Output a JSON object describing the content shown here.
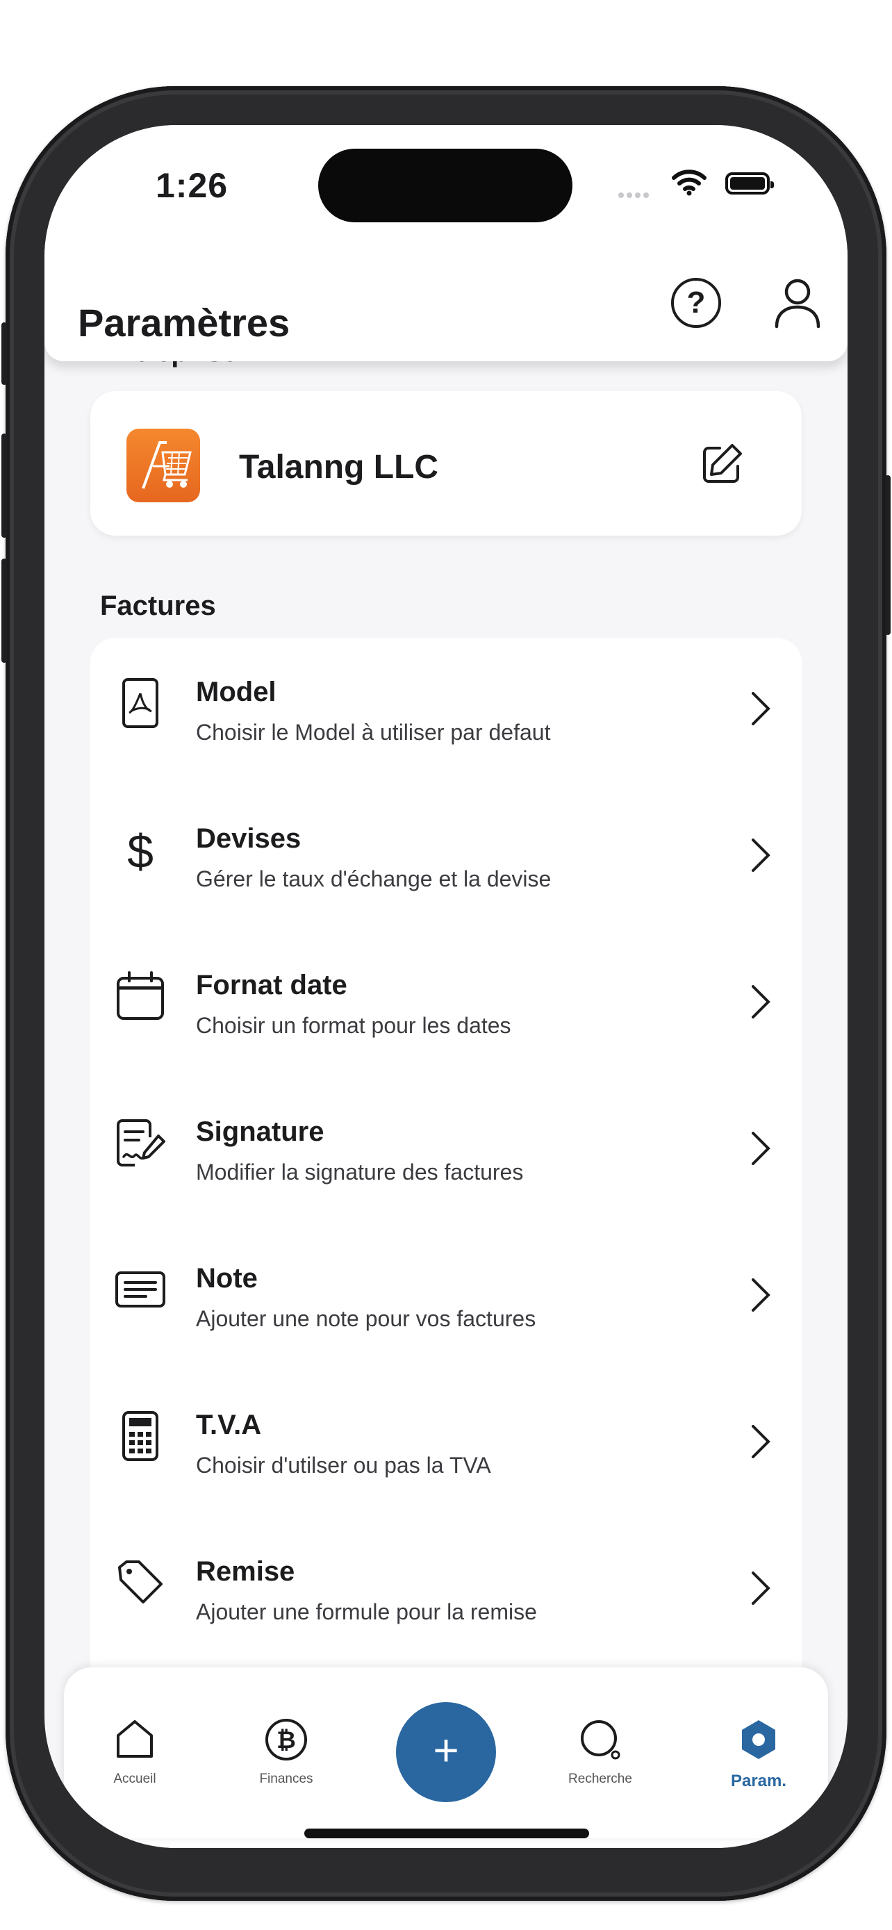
{
  "status": {
    "time": "1:26"
  },
  "header": {
    "title": "Paramètres"
  },
  "company_section": {
    "title": "Entreprise",
    "company_name": "Talanng LLC"
  },
  "invoices_section": {
    "title": "Factures",
    "items": [
      {
        "title": "Model",
        "subtitle": "Choisir le Model à utiliser par defaut",
        "icon": "pdf-file-icon"
      },
      {
        "title": "Devises",
        "subtitle": "Gérer le taux d'échange et la devise",
        "icon": "dollar-icon"
      },
      {
        "title": "Fornat date",
        "subtitle": "Choisir un format pour les dates",
        "icon": "calendar-icon"
      },
      {
        "title": "Signature",
        "subtitle": "Modifier la signature des factures",
        "icon": "signature-icon"
      },
      {
        "title": "Note",
        "subtitle": "Ajouter une note pour vos factures",
        "icon": "note-icon"
      },
      {
        "title": "T.V.A",
        "subtitle": "Choisir d'utilser ou pas la TVA",
        "icon": "calculator-icon"
      },
      {
        "title": "Remise",
        "subtitle": "Ajouter une formule pour la remise",
        "icon": "tag-icon"
      }
    ]
  },
  "tabbar": {
    "tabs": [
      {
        "label": "Accueil",
        "icon": "home-icon"
      },
      {
        "label": "Finances",
        "icon": "bitcoin-icon"
      },
      {
        "label": "Recherche",
        "icon": "search-icon"
      },
      {
        "label": "Param.",
        "icon": "settings-hexagon-icon",
        "active": true
      }
    ],
    "fab_label": "+",
    "accent_color": "#2a67a1"
  }
}
